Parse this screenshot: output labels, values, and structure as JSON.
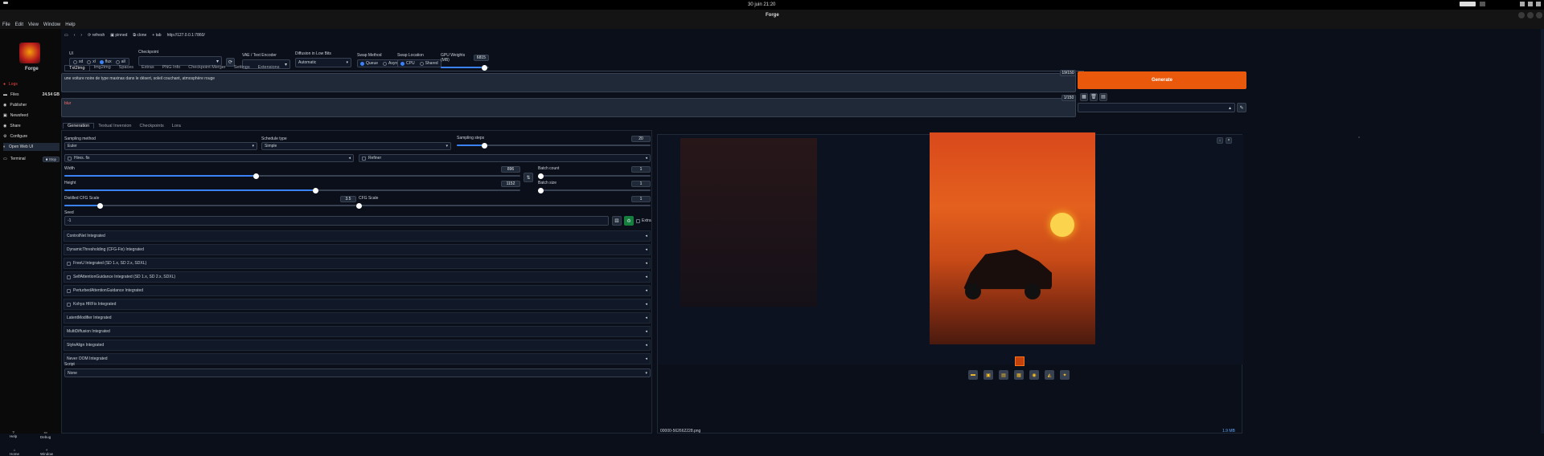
{
  "topbar": {
    "datetime": "30 juin  21:20"
  },
  "window": {
    "title": "Forge"
  },
  "menu": [
    "File",
    "Edit",
    "View",
    "Window",
    "Help"
  ],
  "sidebar": {
    "app_name": "Forge",
    "items": [
      {
        "label": "Logs",
        "icon": "logs-icon",
        "active": true
      },
      {
        "label": "Files",
        "icon": "folder-icon",
        "badge": "24.54 GB"
      },
      {
        "label": "Publisher",
        "icon": "publisher-icon"
      },
      {
        "label": "Newsfeed",
        "icon": "newsfeed-icon"
      },
      {
        "label": "Share",
        "icon": "share-icon"
      },
      {
        "label": "Configure",
        "icon": "gear-icon"
      },
      {
        "label": "Open Web UI",
        "icon": "globe-icon"
      },
      {
        "label": "Terminal",
        "icon": "terminal-icon",
        "action": "Stop"
      }
    ],
    "bottom": [
      {
        "label": "Help",
        "icon": "help-icon"
      },
      {
        "label": "Debug",
        "icon": "debug-icon"
      },
      {
        "label": "Home",
        "icon": "home-icon"
      },
      {
        "label": "Window",
        "icon": "window-icon"
      }
    ]
  },
  "browser": {
    "refresh": "refresh",
    "pinned": "pinned",
    "clone": "clone",
    "tab": "tab",
    "url": "http://127.0.0.1:7860/"
  },
  "settings": {
    "ui_label": "UI",
    "ui_options": [
      "sd",
      "xl",
      "flux",
      "all"
    ],
    "ui_selected": "flux",
    "checkpoint_label": "Checkpoint",
    "checkpoint_value": "",
    "vae_label": "VAE / Text Encoder",
    "vae_value": "",
    "diffusion_label": "Diffusion in Low Bits",
    "diffusion_value": "Automatic",
    "swap_method_label": "Swap Method",
    "swap_method_options": [
      "Queue",
      "Async"
    ],
    "swap_location_label": "Swap Location",
    "swap_location_options": [
      "CPU",
      "Shared"
    ],
    "gpu_weights_label": "GPU Weights (MB)",
    "gpu_weights_value": "6815"
  },
  "tabs": [
    "Txt2img",
    "Img2img",
    "Spaces",
    "Extras",
    "PNG Info",
    "Checkpoint Merger",
    "Settings",
    "Extensions"
  ],
  "prompt": {
    "text": "une voiture noire de type  maxinas dans le désert, soleil couchant, atmosphère rouge",
    "counter": "19/150",
    "negative_text": "blur",
    "negative_counter": "1/150"
  },
  "generate_label": "Generate",
  "subtabs": [
    "Generation",
    "Textual Inversion",
    "Checkpoints",
    "Lora"
  ],
  "params": {
    "sampling_method_label": "Sampling method",
    "sampling_method_value": "Euler",
    "schedule_type_label": "Schedule type",
    "schedule_type_value": "Simple",
    "sampling_steps_label": "Sampling steps",
    "sampling_steps_value": "20",
    "sampling_steps_fraction": 0.14,
    "hires_label": "Hires. fix",
    "refiner_label": "Refiner",
    "width_label": "Width",
    "width_value": "896",
    "width_fraction": 0.42,
    "height_label": "Height",
    "height_value": "1152",
    "height_fraction": 0.55,
    "batch_count_label": "Batch count",
    "batch_count_value": "1",
    "batch_size_label": "Batch size",
    "batch_size_value": "1",
    "distilled_cfg_label": "Distilled CFG Scale",
    "distilled_cfg_value": "3.5",
    "distilled_cfg_fraction": 0.12,
    "cfg_label": "CFG Scale",
    "cfg_value": "1",
    "cfg_fraction": 0.0,
    "seed_label": "Seed",
    "seed_value": "-1",
    "extra_label": "Extra"
  },
  "accordions": [
    {
      "label": "ControlNet Integrated",
      "checkbox": false
    },
    {
      "label": "DynamicThresholding (CFG-Fix) Integrated",
      "checkbox": false
    },
    {
      "label": "FreeU Integrated (SD 1.x, SD 2.x, SDXL)",
      "checkbox": true
    },
    {
      "label": "SelfAttentionGuidance Integrated (SD 1.x, SD 2.x, SDXL)",
      "checkbox": true
    },
    {
      "label": "PerturbedAttentionGuidance Integrated",
      "checkbox": true
    },
    {
      "label": "Kohya HRFix Integrated",
      "checkbox": true
    },
    {
      "label": "LatentModifier Integrated",
      "checkbox": false
    },
    {
      "label": "MultiDiffusion Integrated",
      "checkbox": false
    },
    {
      "label": "StyleAlign Integrated",
      "checkbox": false
    },
    {
      "label": "Never OOM Integrated",
      "checkbox": false
    }
  ],
  "script_label": "Script",
  "script_value": "None",
  "output": {
    "filename": "00000-562662228.png",
    "info": "1.9 MB",
    "tools": [
      "folder-icon",
      "save-icon",
      "zip-icon",
      "image-icon",
      "palette-icon",
      "extras-icon",
      "sparkle-icon"
    ]
  }
}
